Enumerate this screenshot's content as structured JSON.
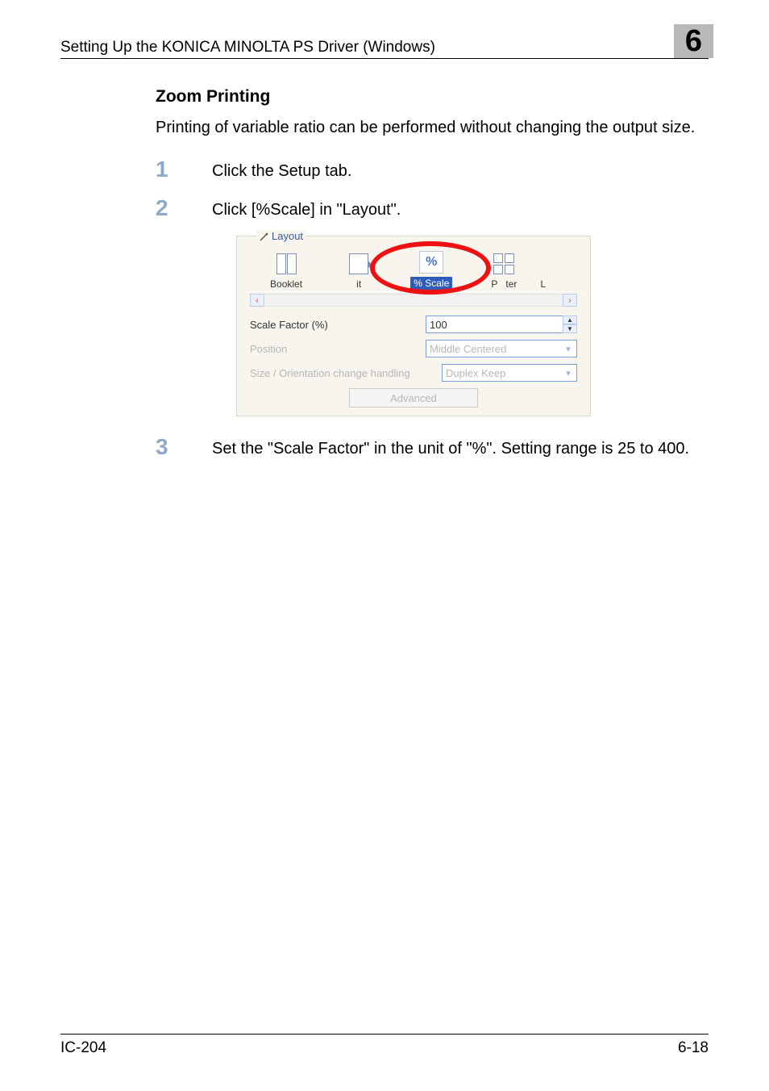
{
  "header": {
    "title": "Setting Up the KONICA MINOLTA PS Driver (Windows)",
    "chapter": "6"
  },
  "section_heading": "Zoom Printing",
  "intro": "Printing of variable ratio can be performed without changing the output size.",
  "steps": {
    "s1": {
      "num": "1",
      "text": "Click the Setup tab."
    },
    "s2": {
      "num": "2",
      "text": "Click [%Scale] in \"Layout\"."
    },
    "s3": {
      "num": "3",
      "text": "Set the \"Scale Factor\" in the unit of \"%\". Setting range is 25 to 400."
    }
  },
  "screenshot": {
    "group_label": "Layout",
    "items": {
      "booklet": "Booklet",
      "fit": "it",
      "scale": "% Scale",
      "scale_icon_text": "%",
      "poster_left": "P",
      "poster_right": "ter",
      "li": "L"
    },
    "rows": {
      "scale_label": "Scale Factor (%)",
      "scale_value": "100",
      "position_label": "Position",
      "position_value": "Middle Centered",
      "size_label": "Size / Orientation change handling",
      "size_value": "Duplex Keep"
    },
    "advanced": "Advanced"
  },
  "footer": {
    "left": "IC-204",
    "right": "6-18"
  }
}
